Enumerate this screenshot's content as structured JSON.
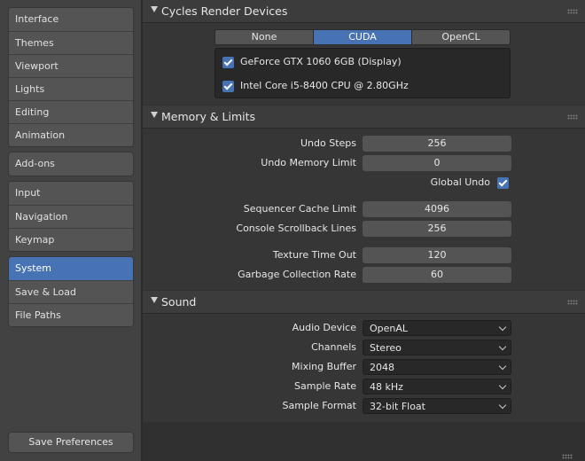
{
  "sidebar": {
    "groups": [
      [
        "Interface",
        "Themes",
        "Viewport",
        "Lights",
        "Editing",
        "Animation"
      ],
      [
        "Add-ons"
      ],
      [
        "Input",
        "Navigation",
        "Keymap"
      ],
      [
        "System",
        "Save & Load",
        "File Paths"
      ]
    ],
    "active": "System",
    "save_label": "Save Preferences"
  },
  "cycles": {
    "title": "Cycles Render Devices",
    "tabs": [
      "None",
      "CUDA",
      "OpenCL"
    ],
    "active_tab": "CUDA",
    "devices": [
      {
        "label": "GeForce GTX 1060 6GB (Display)",
        "checked": true
      },
      {
        "label": "Intel Core i5-8400 CPU @ 2.80GHz",
        "checked": true
      }
    ]
  },
  "memory": {
    "title": "Memory & Limits",
    "undo_steps_label": "Undo Steps",
    "undo_steps": "256",
    "undo_memory_label": "Undo Memory Limit",
    "undo_memory": "0",
    "global_undo_label": "Global Undo",
    "global_undo": true,
    "seq_cache_label": "Sequencer Cache Limit",
    "seq_cache": "4096",
    "scrollback_label": "Console Scrollback Lines",
    "scrollback": "256",
    "texture_timeout_label": "Texture Time Out",
    "texture_timeout": "120",
    "gc_rate_label": "Garbage Collection Rate",
    "gc_rate": "60"
  },
  "sound": {
    "title": "Sound",
    "audio_device_label": "Audio Device",
    "audio_device": "OpenAL",
    "channels_label": "Channels",
    "channels": "Stereo",
    "mixing_buffer_label": "Mixing Buffer",
    "mixing_buffer": "2048",
    "sample_rate_label": "Sample Rate",
    "sample_rate": "48 kHz",
    "sample_format_label": "Sample Format",
    "sample_format": "32-bit Float"
  },
  "colors": {
    "accent": "#4772b3",
    "background": "#303030",
    "sidebar": "#424242"
  }
}
